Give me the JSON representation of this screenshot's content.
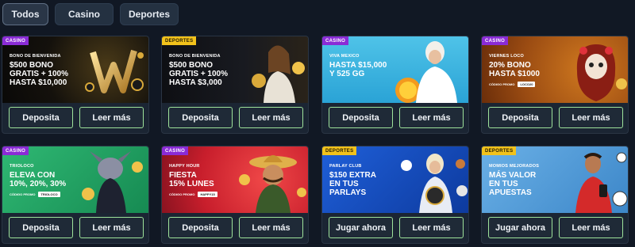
{
  "tabs": [
    {
      "label": "Todos",
      "active": true
    },
    {
      "label": "Casino",
      "active": false
    },
    {
      "label": "Deportes",
      "active": false
    }
  ],
  "colors": {
    "background": "#111824",
    "card": "#1b2533",
    "button_border": "#9ee39b",
    "tag_casino": "#8a2bd6",
    "tag_deportes": "#f2c21b"
  },
  "cards": [
    {
      "tag": "CASINO",
      "tag_type": "casino",
      "eyebrow": "BONO DE BIENVENIDA",
      "headline": "$500 BONO\nGRATIS + 100%\nHASTA $10,000",
      "bg": "dark-gold",
      "art_icon": "gold-w-emblem-icon",
      "buttons": [
        "Deposita",
        "Leer más"
      ]
    },
    {
      "tag": "DEPORTES",
      "tag_type": "deportes",
      "eyebrow": "BONO DE BIENVENIDA",
      "headline": "$500 BONO\nGRATIS + 100%\nHASTA $3,000",
      "bg": "dark",
      "art_icon": "woman-with-trophy-icon",
      "buttons": [
        "Deposita",
        "Leer más"
      ]
    },
    {
      "tag": "CASINO",
      "tag_type": "casino",
      "eyebrow": "VIVA MEXICO",
      "headline": "HASTA $15,000\nY 525 GG",
      "bg": "sky",
      "art_icon": "woman-with-sun-icon",
      "buttons": [
        "Deposita",
        "Leer más"
      ]
    },
    {
      "tag": "CASINO",
      "tag_type": "casino",
      "eyebrow": "VIERNES LOCO",
      "headline": "20% BONO\nHASTA $1000",
      "code_label": "CÓDIGO PROMO",
      "code": "LOCO20",
      "bg": "orange",
      "art_icon": "catrina-icon",
      "buttons": [
        "Deposita",
        "Leer más"
      ]
    },
    {
      "tag": "CASINO",
      "tag_type": "casino",
      "eyebrow": "TRIOLOCO",
      "headline": "ELEVA CON\n10%, 20%, 30%",
      "code_label": "CÓDIGO PROMO",
      "code": "TRIOLOCO",
      "bg": "green",
      "art_icon": "cartoon-dog-icon",
      "buttons": [
        "Deposita",
        "Leer más"
      ]
    },
    {
      "tag": "CASINO",
      "tag_type": "casino",
      "eyebrow": "HAPPY HOUR",
      "headline": "FIESTA\n15% LUNES",
      "code_label": "CÓDIGO PROMO",
      "code": "HAPPY15",
      "bg": "red",
      "art_icon": "mariachi-character-icon",
      "buttons": [
        "Deposita",
        "Leer más"
      ]
    },
    {
      "tag": "DEPORTES",
      "tag_type": "deportes",
      "eyebrow": "PARLAY CLUB",
      "headline": "$150 EXTRA\nEN TUS\nPARLAYS",
      "bg": "blue",
      "art_icon": "woman-with-balls-icon",
      "buttons": [
        "Jugar ahora",
        "Leer más"
      ]
    },
    {
      "tag": "DEPORTES",
      "tag_type": "deportes",
      "eyebrow": "MOMIOS MEJORADOS",
      "headline": "MÁS VALOR\nEN TUS\nAPUESTAS",
      "bg": "light-blue",
      "art_icon": "soccer-player-icon",
      "buttons": [
        "Jugar ahora",
        "Leer más"
      ]
    }
  ]
}
